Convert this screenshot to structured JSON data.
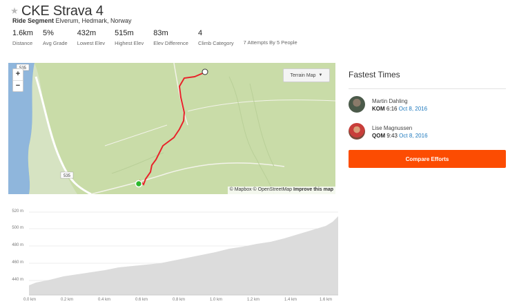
{
  "header": {
    "title": "CKE Strava 4",
    "segment_type": "Ride Segment",
    "location": "Elverum, Hedmark, Norway"
  },
  "stats": [
    {
      "value": "1.6km",
      "label": "Distance"
    },
    {
      "value": "5%",
      "label": "Avg Grade"
    },
    {
      "value": "432m",
      "label": "Lowest Elev"
    },
    {
      "value": "515m",
      "label": "Highest Elev"
    },
    {
      "value": "83m",
      "label": "Elev Difference"
    },
    {
      "value": "4",
      "label": "Climb Category"
    }
  ],
  "attempts": "7 Attempts By 5 People",
  "map": {
    "zoom_in": "+",
    "zoom_out": "−",
    "style_button": "Terrain Map",
    "attribution_1": "© Mapbox © OpenStreetMap",
    "attribution_2": "Improve this map",
    "road_label_1": "535",
    "road_label_2": "535",
    "route_color": "#e8232a",
    "start_color": "#2db82d"
  },
  "fastest": {
    "title": "Fastest Times",
    "leaders": [
      {
        "name": "Martin Dahling",
        "badge": "KOM",
        "time": "6:16",
        "date": "Oct 8, 2016"
      },
      {
        "name": "Lise Magnussen",
        "badge": "QOM",
        "time": "9:43",
        "date": "Oct 8, 2016"
      }
    ],
    "compare_label": "Compare Efforts"
  },
  "elevation": {
    "y_ticks": [
      "520 m",
      "500 m",
      "480 m",
      "460 m",
      "440 m"
    ],
    "x_ticks": [
      "0.0 km",
      "0.2 km",
      "0.4 km",
      "0.6 km",
      "0.8 km",
      "1.0 km",
      "1.2 km",
      "1.4 km",
      "1.6 km"
    ]
  }
}
